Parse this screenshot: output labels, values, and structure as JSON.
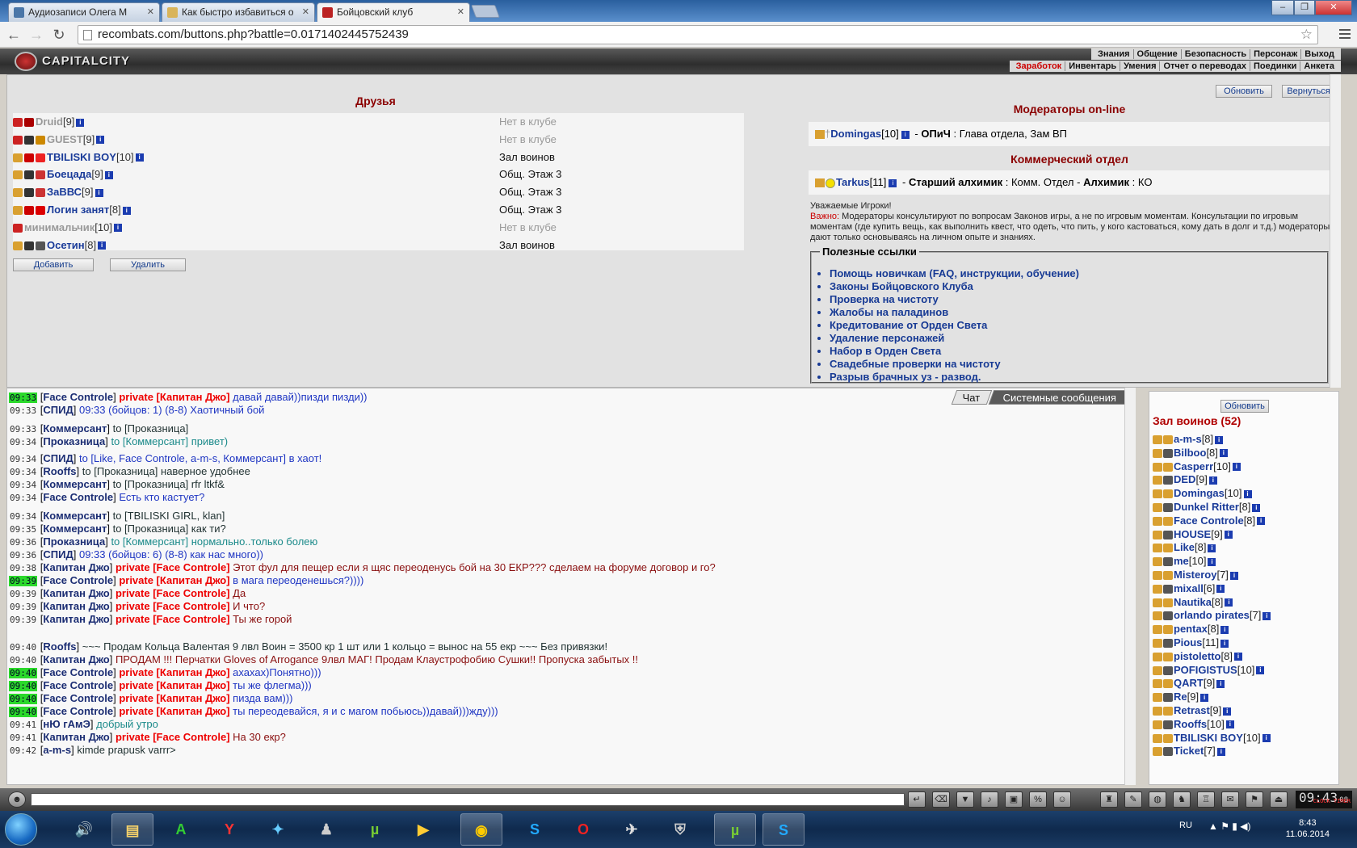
{
  "browser": {
    "tabs": [
      {
        "title": "Аудиозаписи Олега М"
      },
      {
        "title": "Как быстро избавиться о"
      },
      {
        "title": "Бойцовский клуб"
      }
    ],
    "url": "recombats.com/buttons.php?battle=0.0171402445752439"
  },
  "game": {
    "logo": "CAPITALCITY",
    "top_menu": [
      "Знания",
      "Общение",
      "Безопасность",
      "Персонаж",
      "Выход"
    ],
    "sub_menu": [
      "Заработок",
      "Инвентарь",
      "Умения",
      "Отчет о переводах",
      "Поединки",
      "Анкета"
    ]
  },
  "friends": {
    "title": "Друзья",
    "items": [
      {
        "name": "Druid",
        "level": "[9]",
        "location": "Нет в клубе",
        "offline": true
      },
      {
        "name": "GUEST",
        "level": "[9]",
        "location": "Нет в клубе",
        "offline": true
      },
      {
        "name": "TBILISKI BOY",
        "level": "[10]",
        "location": "Зал воинов",
        "offline": false
      },
      {
        "name": "Боецада",
        "level": "[9]",
        "location": "Общ. Этаж 3",
        "offline": false
      },
      {
        "name": "ЗаВВС",
        "level": "[9]",
        "location": "Общ. Этаж 3",
        "offline": false
      },
      {
        "name": "Логин занят",
        "level": "[8]",
        "location": "Общ. Этаж 3",
        "offline": false
      },
      {
        "name": "минимальчик",
        "level": "[10]",
        "location": "Нет в клубе",
        "offline": true
      },
      {
        "name": "Осетин",
        "level": "[8]",
        "location": "Зал воинов",
        "offline": false
      }
    ],
    "add_label": "Добавить",
    "remove_label": "Удалить"
  },
  "buttons": {
    "refresh": "Обновить",
    "back": "Вернуться"
  },
  "moderators": {
    "title": "Модераторы on-line",
    "entry": {
      "name": "Domingas",
      "level": "[10]",
      "rank": "ОПиЧ",
      "role": "Глава отдела, Зам ВП"
    }
  },
  "commercial": {
    "title": "Коммерческий отдел",
    "entry": {
      "name": "Tarkus",
      "level": "[11]",
      "rank1": "Старший алхимик",
      "role1": "Комм. Отдел",
      "rank2": "Алхимик",
      "role2": "КО"
    }
  },
  "notice": {
    "greeting": "Уважаемые Игроки!",
    "important_label": "Важно:",
    "text": "Модераторы консультируют по вопросам Законов игры, а не по игровым моментам. Консультации по игровым моментам (где купить вещь, как выполнить квест, что одеть, что пить, у кого кастоваться, кому дать в долг и т.д.) модераторы дают только основываясь на личном опыте и знаниях."
  },
  "links": {
    "title": "Полезные ссылки",
    "items": [
      "Помощь новичкам (FAQ, инструкции, обучение)",
      "Законы Бойцовского Клуба",
      "Проверка на чистоту",
      "Жалобы на паладинов",
      "Кредитование от Орден Света",
      "Удаление персонажей",
      "Набор в Орден Света",
      "Свадебные проверки на чистоту",
      "Разрыв брачных уз - развод."
    ]
  },
  "chat": {
    "tabs": [
      "Чат",
      "Системные сообщения"
    ],
    "messages": [
      {
        "time": "09:33",
        "hl": true,
        "nick": "Face Controle",
        "pre": "private [Капитан Джо]",
        "text": "давай давай))пизди пизди))",
        "style": "blue"
      },
      {
        "time": "09:33",
        "hl": false,
        "nick": "СПИД",
        "pre": "",
        "text": "09:33 (бойцов: 1) (8-8) Хаотичный бой",
        "style": "blue"
      },
      {
        "time": "09:33",
        "hl": false,
        "nick": "Коммерсант",
        "pre": "",
        "text": "to [Проказница]",
        "style": ""
      },
      {
        "time": "09:34",
        "hl": false,
        "nick": "Проказница",
        "pre": "",
        "text": "to [Коммерсант] привет)",
        "style": "teal"
      },
      {
        "time": "09:34",
        "hl": false,
        "nick": "СПИД",
        "pre": "",
        "text": "to [Like, Face Controle, a-m-s, Коммерсант] в хаот!",
        "style": "blue"
      },
      {
        "time": "09:34",
        "hl": false,
        "nick": "Rooffs",
        "pre": "",
        "text": "to [Проказница] наверное удобнее",
        "style": ""
      },
      {
        "time": "09:34",
        "hl": false,
        "nick": "Коммерсант",
        "pre": "",
        "text": "to [Проказница] rfr ltkf&",
        "style": ""
      },
      {
        "time": "09:34",
        "hl": false,
        "nick": "Face Controle",
        "pre": "",
        "text": "Есть кто кастует?",
        "style": "blue"
      },
      {
        "time": "09:34",
        "hl": false,
        "nick": "Коммерсант",
        "pre": "",
        "text": "to [TBILISKI GIRL, klan]",
        "style": ""
      },
      {
        "time": "09:35",
        "hl": false,
        "nick": "Коммерсант",
        "pre": "",
        "text": "to [Проказница] как ти?",
        "style": ""
      },
      {
        "time": "09:36",
        "hl": false,
        "nick": "Проказница",
        "pre": "",
        "text": "to [Коммерсант] нормально..только болею",
        "style": "teal"
      },
      {
        "time": "09:36",
        "hl": false,
        "nick": "СПИД",
        "pre": "",
        "text": "09:33 (бойцов: 6) (8-8) как нас много))",
        "style": "blue"
      },
      {
        "time": "09:38",
        "hl": false,
        "nick": "Капитан Джо",
        "pre": "private [Face Controle]",
        "text": "Этот фул для пещер если я щяс переоденусь бой на 30 ЕКР??? сделаем на форуме договор и го?",
        "style": "dred"
      },
      {
        "time": "09:39",
        "hl": true,
        "nick": "Face Controle",
        "pre": "private [Капитан Джо]",
        "text": "в мага переоденешься?))))",
        "style": "blue"
      },
      {
        "time": "09:39",
        "hl": false,
        "nick": "Капитан Джо",
        "pre": "private [Face Controle]",
        "text": "Да",
        "style": "dred"
      },
      {
        "time": "09:39",
        "hl": false,
        "nick": "Капитан Джо",
        "pre": "private [Face Controle]",
        "text": "И что?",
        "style": "dred"
      },
      {
        "time": "09:39",
        "hl": false,
        "nick": "Капитан Джо",
        "pre": "private [Face Controle]",
        "text": "Ты же горой",
        "style": "dred"
      },
      {
        "time": "09:40",
        "hl": false,
        "nick": "Rooffs",
        "pre": "",
        "text": "~~~ Продам Кольца Валентая 9 лвл Воин = 3500 кр 1 шт или 1 кольцо = вынос на 55 екр ~~~ Без привязки!",
        "style": ""
      },
      {
        "time": "09:40",
        "hl": false,
        "nick": "Капитан Джо",
        "pre": "",
        "text": "ПРОДАМ !!! Перчатки Gloves of Arrogance 9лвл МАГ! Продам Клаустрофобию Сушки!! Пропуска забытых !!",
        "style": "dred"
      },
      {
        "time": "09:40",
        "hl": true,
        "nick": "Face Controle",
        "pre": "private [Капитан Джо]",
        "text": "ахахах)Понятно)))",
        "style": "blue"
      },
      {
        "time": "09:40",
        "hl": true,
        "nick": "Face Controle",
        "pre": "private [Капитан Джо]",
        "text": "ты же флегма)))",
        "style": "blue"
      },
      {
        "time": "09:40",
        "hl": true,
        "nick": "Face Controle",
        "pre": "private [Капитан Джо]",
        "text": "пизда вам)))",
        "style": "blue"
      },
      {
        "time": "09:40",
        "hl": true,
        "nick": "Face Controle",
        "pre": "private [Капитан Джо]",
        "text": "ты переодевайся, я и с магом побьюсь))давай)))жду)))",
        "style": "blue"
      },
      {
        "time": "09:41",
        "hl": false,
        "nick": "нЮ гАмЭ",
        "pre": "",
        "text": "добрый утро",
        "style": "teal"
      },
      {
        "time": "09:41",
        "hl": false,
        "nick": "Капитан Джо",
        "pre": "private [Face Controle]",
        "text": "На 30 екр?",
        "style": "dred"
      },
      {
        "time": "09:42",
        "hl": false,
        "nick": "a-m-s",
        "pre": "",
        "text": "kimde prapusk varrr>",
        "style": ""
      }
    ]
  },
  "online": {
    "title": "Зал воинов (52)",
    "refresh": "Обновить",
    "items": [
      {
        "name": "a-m-s",
        "level": "[8]"
      },
      {
        "name": "Bilboo",
        "level": "[8]"
      },
      {
        "name": "Casperr",
        "level": "[10]"
      },
      {
        "name": "DED",
        "level": "[9]"
      },
      {
        "name": "Domingas",
        "level": "[10]"
      },
      {
        "name": "Dunkel Ritter",
        "level": "[8]"
      },
      {
        "name": "Face Controle",
        "level": "[8]"
      },
      {
        "name": "HOUSE",
        "level": "[9]"
      },
      {
        "name": "Like",
        "level": "[8]"
      },
      {
        "name": "me",
        "level": "[10]"
      },
      {
        "name": "Misteroy",
        "level": "[7]"
      },
      {
        "name": "mixall",
        "level": "[6]"
      },
      {
        "name": "Nautika",
        "level": "[8]"
      },
      {
        "name": "orlando pirates",
        "level": "[7]"
      },
      {
        "name": "pentax",
        "level": "[8]"
      },
      {
        "name": "Pious",
        "level": "[11]"
      },
      {
        "name": "pistoletto",
        "level": "[8]"
      },
      {
        "name": "POFIGISTUS",
        "level": "[10]"
      },
      {
        "name": "QART",
        "level": "[9]"
      },
      {
        "name": "Re",
        "level": "[9]"
      },
      {
        "name": "Retrast",
        "level": "[9]"
      },
      {
        "name": "Rooffs",
        "level": "[10]"
      },
      {
        "name": "TBILISKI BOY",
        "level": "[10]"
      },
      {
        "name": "Ticket",
        "level": "[7]"
      }
    ]
  },
  "clock": {
    "time": "09:43",
    "seconds": "08",
    "label": "CLOCK TIMER"
  },
  "taskbar": {
    "lang": "RU",
    "time": "8:43",
    "date": "11.06.2014"
  },
  "colors": {
    "accent_red": "#8b0000",
    "nick_blue": "#1a3b99",
    "time_highlight": "#2bd92b"
  }
}
